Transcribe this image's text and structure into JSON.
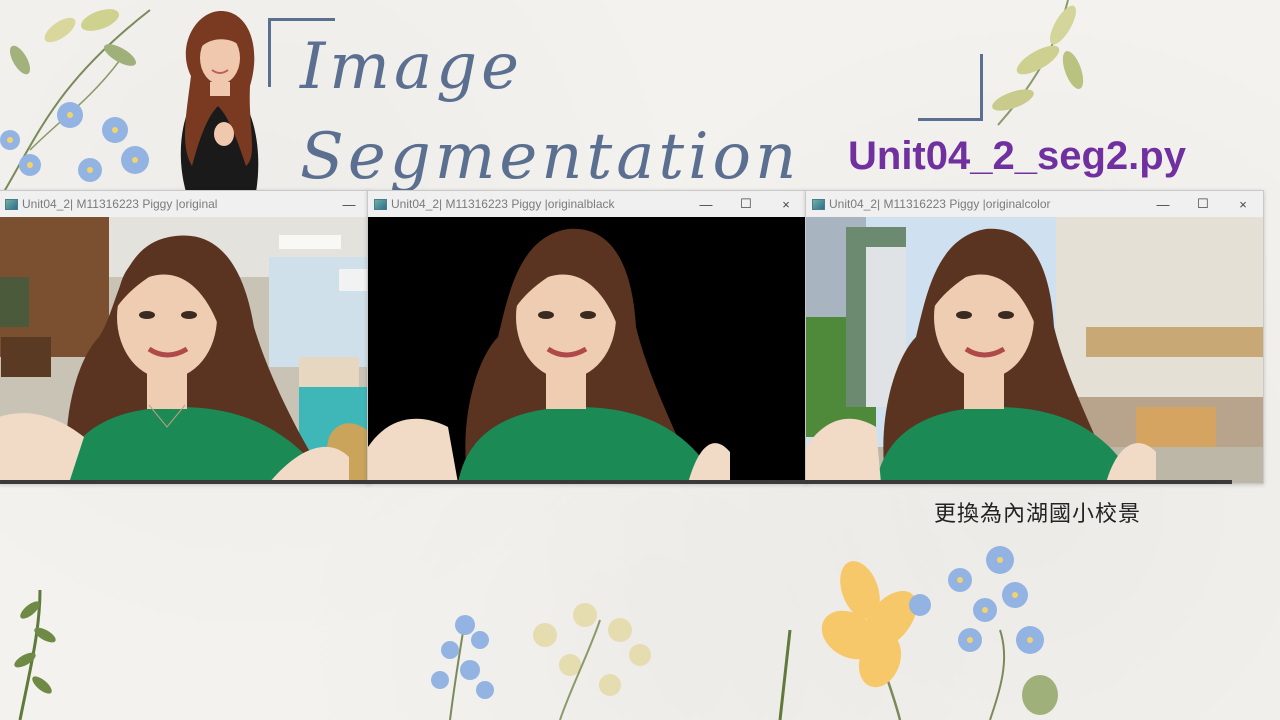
{
  "title": "Image Segmentation",
  "subtitle": "Unit04_2_seg2.py",
  "caption": "更換為內湖國小校景",
  "windows": [
    {
      "title": "Unit04_2| M11316223 Piggy |original",
      "buttons": [
        "—"
      ],
      "background": "office"
    },
    {
      "title": "Unit04_2| M11316223 Piggy |originalblack",
      "buttons": [
        "—",
        "☐",
        "×"
      ],
      "background": "black"
    },
    {
      "title": "Unit04_2| M11316223 Piggy |originalcolor",
      "buttons": [
        "—",
        "☐",
        "×"
      ],
      "background": "school"
    }
  ],
  "colors": {
    "title": "#5b6f91",
    "subtitle": "#7030a0",
    "dress": "#1c8a55",
    "hair": "#5a3420"
  }
}
